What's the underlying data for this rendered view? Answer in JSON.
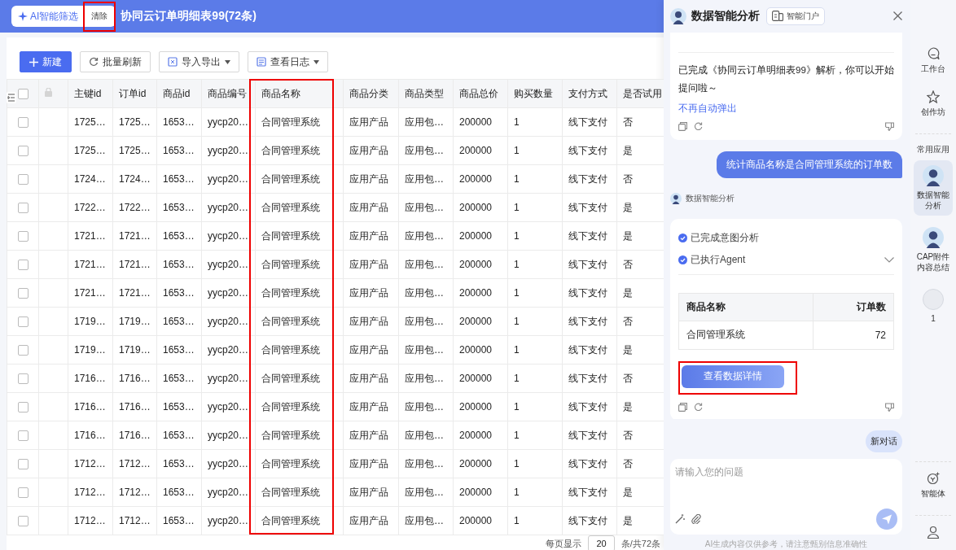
{
  "header": {
    "ai_filter_button": "AI智能筛选",
    "clear_button": {
      "label": "清除",
      "highlighted": true
    },
    "title": "协同云订单明细表99(72条)"
  },
  "toolbar": [
    {
      "label": "新建",
      "kind": "primary"
    },
    {
      "label": "批量刷新",
      "kind": "refresh"
    },
    {
      "label": "导入导出",
      "kind": "import"
    },
    {
      "label": "查看日志",
      "kind": "log"
    }
  ],
  "table": {
    "select_all_checked": false,
    "columns": [
      {
        "label": "主键id",
        "highlighted": false
      },
      {
        "label": "订单id",
        "highlighted": false
      },
      {
        "label": "商品id",
        "highlighted": false
      },
      {
        "label": "商品编号",
        "highlighted": false
      },
      {
        "label": "商品名称",
        "highlighted": true
      },
      {
        "label": "商品分类",
        "highlighted": false
      },
      {
        "label": "商品类型",
        "highlighted": false
      },
      {
        "label": "商品总价",
        "highlighted": false
      },
      {
        "label": "购买数量",
        "highlighted": false
      },
      {
        "label": "支付方式",
        "highlighted": false
      },
      {
        "label": "是否试用",
        "highlighted": false
      }
    ],
    "rows": [
      {
        "checked": false,
        "cells": [
          "1725…",
          "1725…",
          "1653…",
          "yycp20…",
          "合同管理系统",
          "应用产品",
          "应用包…",
          "200000",
          "1",
          "线下支付",
          "否"
        ]
      },
      {
        "checked": false,
        "cells": [
          "1725…",
          "1725…",
          "1653…",
          "yycp20…",
          "合同管理系统",
          "应用产品",
          "应用包…",
          "200000",
          "1",
          "线下支付",
          "是"
        ]
      },
      {
        "checked": false,
        "cells": [
          "1724…",
          "1724…",
          "1653…",
          "yycp20…",
          "合同管理系统",
          "应用产品",
          "应用包…",
          "200000",
          "1",
          "线下支付",
          "否"
        ]
      },
      {
        "checked": false,
        "cells": [
          "1722…",
          "1722…",
          "1653…",
          "yycp20…",
          "合同管理系统",
          "应用产品",
          "应用包…",
          "200000",
          "1",
          "线下支付",
          "是"
        ]
      },
      {
        "checked": false,
        "cells": [
          "1721…",
          "1721…",
          "1653…",
          "yycp20…",
          "合同管理系统",
          "应用产品",
          "应用包…",
          "200000",
          "1",
          "线下支付",
          "是"
        ]
      },
      {
        "checked": false,
        "cells": [
          "1721…",
          "1721…",
          "1653…",
          "yycp20…",
          "合同管理系统",
          "应用产品",
          "应用包…",
          "200000",
          "1",
          "线下支付",
          "否"
        ]
      },
      {
        "checked": false,
        "cells": [
          "1721…",
          "1721…",
          "1653…",
          "yycp20…",
          "合同管理系统",
          "应用产品",
          "应用包…",
          "200000",
          "1",
          "线下支付",
          "是"
        ]
      },
      {
        "checked": false,
        "cells": [
          "1719…",
          "1719…",
          "1653…",
          "yycp20…",
          "合同管理系统",
          "应用产品",
          "应用包…",
          "200000",
          "1",
          "线下支付",
          "否"
        ]
      },
      {
        "checked": false,
        "cells": [
          "1719…",
          "1719…",
          "1653…",
          "yycp20…",
          "合同管理系统",
          "应用产品",
          "应用包…",
          "200000",
          "1",
          "线下支付",
          "是"
        ]
      },
      {
        "checked": false,
        "cells": [
          "1716…",
          "1716…",
          "1653…",
          "yycp20…",
          "合同管理系统",
          "应用产品",
          "应用包…",
          "200000",
          "1",
          "线下支付",
          "否"
        ]
      },
      {
        "checked": false,
        "cells": [
          "1716…",
          "1716…",
          "1653…",
          "yycp20…",
          "合同管理系统",
          "应用产品",
          "应用包…",
          "200000",
          "1",
          "线下支付",
          "是"
        ]
      },
      {
        "checked": false,
        "cells": [
          "1716…",
          "1716…",
          "1653…",
          "yycp20…",
          "合同管理系统",
          "应用产品",
          "应用包…",
          "200000",
          "1",
          "线下支付",
          "否"
        ]
      },
      {
        "checked": false,
        "cells": [
          "1712…",
          "1712…",
          "1653…",
          "yycp20…",
          "合同管理系统",
          "应用产品",
          "应用包…",
          "200000",
          "1",
          "线下支付",
          "否"
        ]
      },
      {
        "checked": false,
        "cells": [
          "1712…",
          "1712…",
          "1653…",
          "yycp20…",
          "合同管理系统",
          "应用产品",
          "应用包…",
          "200000",
          "1",
          "线下支付",
          "是"
        ]
      },
      {
        "checked": false,
        "cells": [
          "1712…",
          "1712…",
          "1653…",
          "yycp20…",
          "合同管理系统",
          "应用产品",
          "应用包…",
          "200000",
          "1",
          "线下支付",
          "是"
        ]
      }
    ]
  },
  "pagination": {
    "page_size_label": "每页显示",
    "page_size": "20",
    "total": "条/共72条"
  },
  "assistant": {
    "title": "数据智能分析",
    "portal_button": "智能门户",
    "intro_message": {
      "text": "已完成《协同云订单明细表99》解析，你可以开始提问啦～",
      "link": "不再自动弹出"
    },
    "user_message": "统计商品名称是合同管理系统的订单数",
    "bot_name": "数据智能分析",
    "steps": [
      {
        "label": "已完成意图分析",
        "expandable": false
      },
      {
        "label": "已执行Agent",
        "expandable": true
      }
    ],
    "result_table": {
      "columns": [
        "商品名称",
        "订单数"
      ],
      "rows": [
        [
          "合同管理系统",
          "72"
        ]
      ]
    },
    "detail_button": {
      "label": "查看数据详情",
      "highlighted": true
    },
    "new_chat_button": "新对话",
    "input_placeholder": "请输入您的问题",
    "disclaimer": "AI生成内容仅供参考，请注意甄别信息准确性"
  },
  "rail": [
    {
      "label": "工作台",
      "kind": "workbench",
      "selected": false
    },
    {
      "label": "创作坊",
      "kind": "workshop",
      "selected": false
    },
    {
      "label": "常用应用",
      "kind": "section"
    },
    {
      "label": "数据智能分析",
      "kind": "avatar",
      "selected": true
    },
    {
      "label": "CAP附件内容总结",
      "kind": "avatar",
      "selected": false
    },
    {
      "label": "1",
      "kind": "blank",
      "selected": false
    },
    {
      "label": "智能体",
      "kind": "agent",
      "selected": false
    },
    {
      "kind": "user"
    }
  ]
}
